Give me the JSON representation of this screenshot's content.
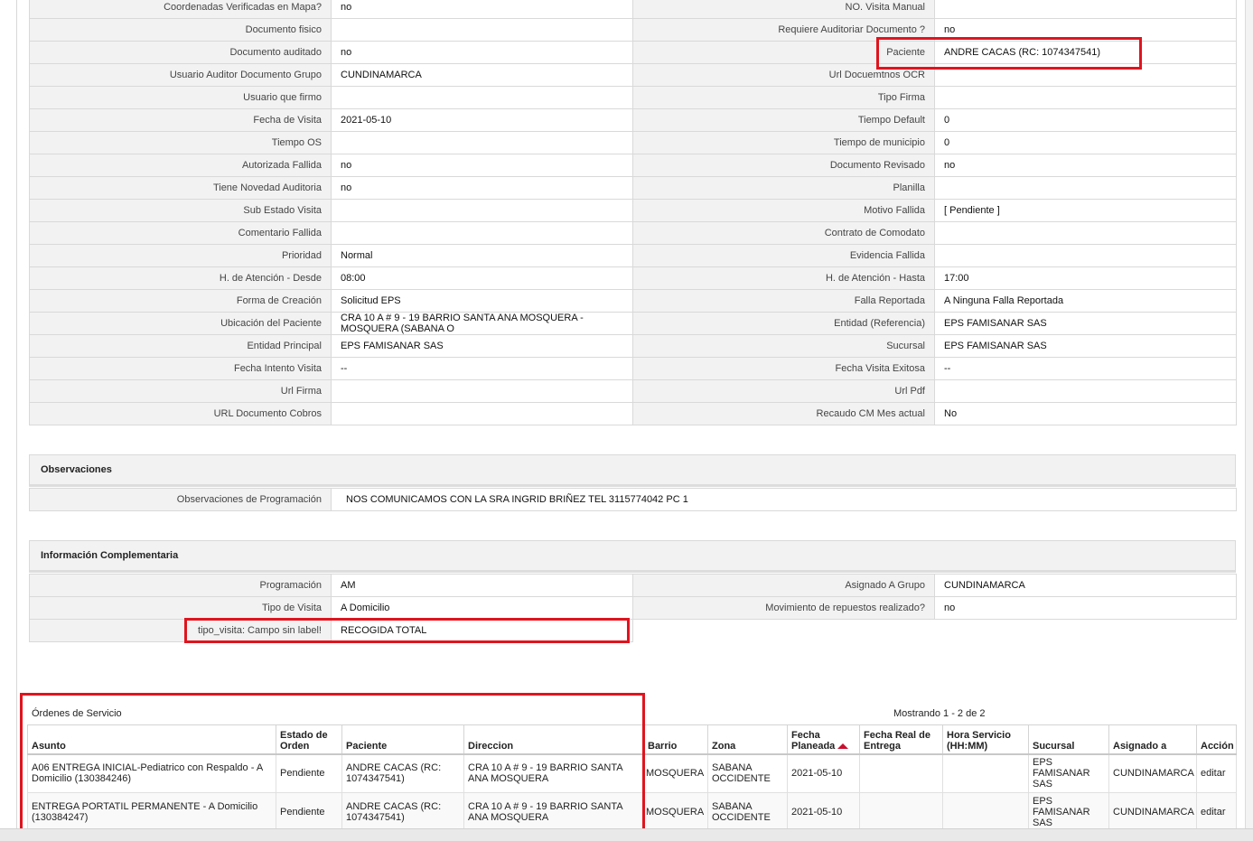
{
  "details": {
    "rows": [
      {
        "l1": "Coordenadas Verificadas en Mapa?",
        "v1": "no",
        "l2": "NO. Visita Manual",
        "v2": ""
      },
      {
        "l1": "Documento fisico",
        "v1": "",
        "l2": "Requiere Auditoriar Documento ?",
        "v2": "no"
      },
      {
        "l1": "Documento auditado",
        "v1": "no",
        "l2": "Paciente",
        "v2": "ANDRE CACAS (RC: 1074347541)"
      },
      {
        "l1": "Usuario Auditor Documento Grupo",
        "v1": "CUNDINAMARCA",
        "l2": "Url Docuemtnos OCR",
        "v2": ""
      },
      {
        "l1": "Usuario que firmo",
        "v1": "",
        "l2": "Tipo Firma",
        "v2": ""
      },
      {
        "l1": "Fecha de Visita",
        "v1": "2021-05-10",
        "l2": "Tiempo Default",
        "v2": "0"
      },
      {
        "l1": "Tiempo OS",
        "v1": "",
        "l2": "Tiempo de municipio",
        "v2": "0"
      },
      {
        "l1": "Autorizada Fallida",
        "v1": "no",
        "l2": "Documento Revisado",
        "v2": "no"
      },
      {
        "l1": "Tiene Novedad Auditoria",
        "v1": "no",
        "l2": "Planilla",
        "v2": ""
      },
      {
        "l1": "Sub Estado Visita",
        "v1": "",
        "l2": "Motivo Fallida",
        "v2": "[ Pendiente ]"
      },
      {
        "l1": "Comentario Fallida",
        "v1": "",
        "l2": "Contrato de Comodato",
        "v2": ""
      },
      {
        "l1": "Prioridad",
        "v1": "Normal",
        "l2": "Evidencia Fallida",
        "v2": ""
      },
      {
        "l1": "H. de Atención - Desde",
        "v1": "08:00",
        "l2": "H. de Atención - Hasta",
        "v2": "17:00"
      },
      {
        "l1": "Forma de Creación",
        "v1": "Solicitud EPS",
        "l2": "Falla Reportada",
        "v2": "A Ninguna Falla Reportada"
      },
      {
        "l1": "Ubicación del Paciente",
        "v1": "CRA 10 A # 9 - 19 BARRIO SANTA ANA MOSQUERA - MOSQUERA (SABANA O",
        "l2": "Entidad (Referencia)",
        "v2": "EPS FAMISANAR SAS"
      },
      {
        "l1": "Entidad Principal",
        "v1": "EPS FAMISANAR SAS",
        "l2": "Sucursal",
        "v2": "EPS FAMISANAR SAS"
      },
      {
        "l1": "Fecha Intento Visita",
        "v1": "--",
        "l2": "Fecha Visita Exitosa",
        "v2": "--"
      },
      {
        "l1": "Url Firma",
        "v1": "",
        "l2": "Url Pdf",
        "v2": ""
      },
      {
        "l1": "URL Documento Cobros",
        "v1": "",
        "l2": "Recaudo CM Mes actual",
        "v2": "No"
      }
    ]
  },
  "observaciones": {
    "title": "Observaciones",
    "label": "Observaciones de Programación",
    "value": "NOS COMUNICAMOS CON LA SRA INGRID BRIÑEZ TEL 3115774042 PC 1"
  },
  "complementaria": {
    "title": "Información Complementaria",
    "rows": [
      {
        "l1": "Programación",
        "v1": "AM",
        "l2": "Asignado A Grupo",
        "v2": "CUNDINAMARCA"
      },
      {
        "l1": "Tipo de Visita",
        "v1": "A Domicilio",
        "l2": "Movimiento de repuestos realizado?",
        "v2": "no"
      }
    ],
    "extra": {
      "label": "tipo_visita: Campo sin label!",
      "value": "RECOGIDA TOTAL"
    }
  },
  "orders": {
    "title": "Órdenes de Servicio",
    "count_text": "Mostrando 1 - 2 de 2",
    "headers": [
      "Asunto",
      "Estado de Orden",
      "Paciente",
      "Direccion",
      "Barrio",
      "Zona",
      "Fecha Planeada",
      "Fecha Real de Entrega",
      "Hora Servicio (HH:MM)",
      "Sucursal",
      "Asignado a",
      "Acción"
    ],
    "rows": [
      {
        "asunto": "A06 ENTREGA INICIAL-Pediatrico con Respaldo - A Domicilio (130384246)",
        "estado": "Pendiente",
        "paciente": "ANDRE CACAS (RC: 1074347541)",
        "direccion": "CRA 10 A # 9 - 19 BARRIO SANTA ANA MOSQUERA",
        "barrio": "MOSQUERA",
        "zona": "SABANA OCCIDENTE",
        "fecha_planeada": "2021-05-10",
        "fecha_real": "",
        "hora": "",
        "sucursal": "EPS FAMISANAR SAS",
        "asignado": "CUNDINAMARCA",
        "accion": "editar"
      },
      {
        "asunto": "ENTREGA PORTATIL PERMANENTE - A Domicilio (130384247)",
        "estado": "Pendiente",
        "paciente": "ANDRE CACAS (RC: 1074347541)",
        "direccion": "CRA 10 A # 9 - 19 BARRIO SANTA ANA MOSQUERA",
        "barrio": "MOSQUERA",
        "zona": "SABANA OCCIDENTE",
        "fecha_planeada": "2021-05-10",
        "fecha_real": "",
        "hora": "",
        "sucursal": "EPS FAMISANAR SAS",
        "asignado": "CUNDINAMARCA",
        "accion": "editar"
      }
    ]
  },
  "colors": {
    "highlight": "#e0141e",
    "label_bg": "#f2f2f2",
    "link": "#1a3f8a"
  }
}
